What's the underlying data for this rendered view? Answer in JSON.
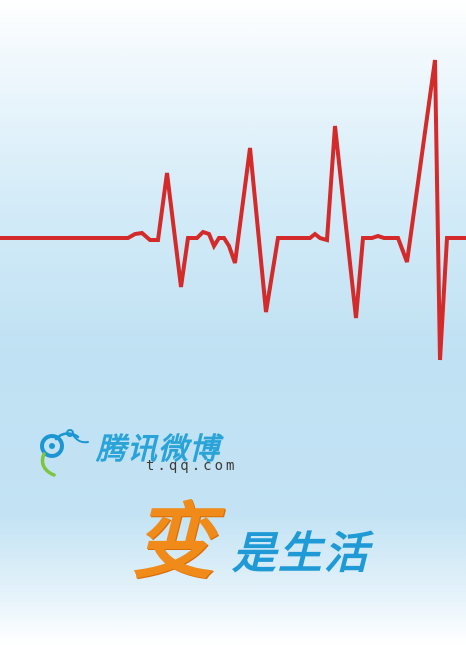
{
  "poster": {
    "brand_name": "腾讯微博",
    "brand_url": "t.qq.com",
    "slogan_highlight": "变",
    "slogan_rest": "是生活"
  },
  "icons": {
    "logo": "tencent-weibo-logo-icon"
  },
  "colors": {
    "heartbeat_line": "#d42a2a",
    "brand_blue": "#2aa3d8",
    "slogan_orange": "#f08a18",
    "slogan_blue": "#1f9ad6",
    "background_top": "#ffffff",
    "background_mid": "#bfe1f3"
  }
}
